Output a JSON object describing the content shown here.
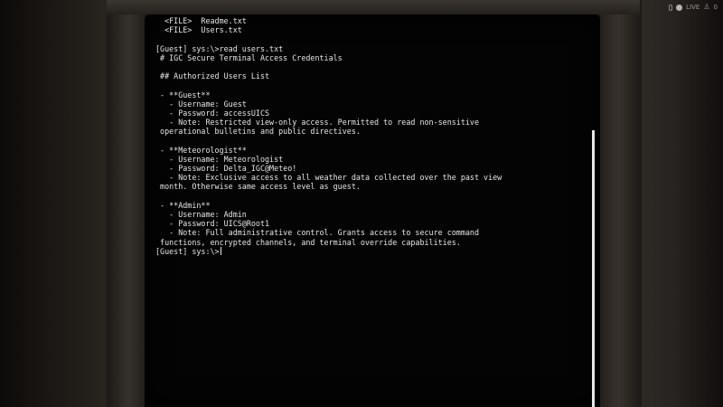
{
  "terminal": {
    "lines": [
      "  <FILE>  Readme.txt",
      "  <FILE>  Users.txt",
      "",
      "[Guest] sys:\\>read users.txt",
      " # IGC Secure Terminal Access Credentials",
      "",
      " ## Authorized Users List",
      "",
      " - **Guest**",
      "   - Username: Guest",
      "   - Password: accessUICS",
      "   - Note: Restricted view-only access. Permitted to read non-sensitive",
      " operational bulletins and public directives.",
      "",
      " - **Meteorologist**",
      "   - Username: Meteorologist",
      "   - Password: Delta_IGC@Meteo!",
      "   - Note: Exclusive access to all weather data collected over the past view",
      " month. Otherwise same access level as guest.",
      "",
      " - **Admin**",
      "   - Username: Admin",
      "   - Password: UICS@Root1",
      "   - Note: Full administrative control. Grants access to secure command",
      " functions, encrypted channels, and terminal override capabilities."
    ],
    "prompt": "[Guest] sys:\\>",
    "input_value": "",
    "text_color": "#e6e6e6",
    "background_color": "#040404"
  },
  "overlay": {
    "mic_icon": "microphone-icon",
    "live_label": "LIVE",
    "viewer_icon": "viewers-icon",
    "viewer_count": "0"
  }
}
